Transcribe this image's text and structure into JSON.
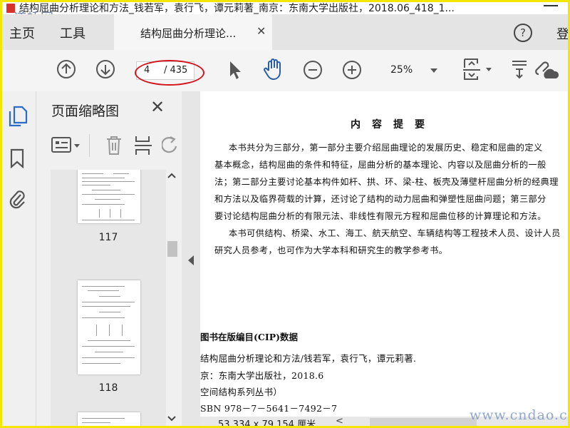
{
  "window": {
    "title": "结构屈曲分析理论和方法_钱若军，袁行飞，谭元莉著_南京：东南大学出版社，2018.06_418_1..."
  },
  "watermarks": {
    "top_left": "道桥网",
    "bottom_right": "www.cndao.com"
  },
  "menu": {
    "home": "主页",
    "tools": "工具",
    "tab_label": "结构屈曲分析理论...",
    "login": "登"
  },
  "toolbar": {
    "current_page": "4",
    "total_pages": "/ 435",
    "zoom": "25%"
  },
  "panel": {
    "title": "页面缩略图",
    "thumbnails": [
      {
        "label": "117"
      },
      {
        "label": "118"
      }
    ]
  },
  "document": {
    "heading": "内容提要",
    "summary_lines": [
      "本书共分为三部分，第一部分主要介绍屈曲理论的发展历史、稳定和屈曲的定义",
      "基本概念，结构屈曲的条件和特征，屈曲分析的基本理论、内容以及屈曲分析的一般",
      "法；第二部分主要讨论基本构件如杆、拱、环、梁-柱、板壳及薄壁杆屈曲分析的经典理",
      "和方法以及临界荷载的计算，还讨论了结构的动力屈曲和弹塑性屈曲问题；第三部分",
      "要讨论结构屈曲分析的有限元法、非线性有限元方程和屈曲位移的计算理论和方法。",
      "本书可供结构、桥梁、水工、海工、航天航空、车辆结构等工程技术人员、设计人员",
      "研究人员参考，也可作为大学本科和研究生的教学参考书。"
    ],
    "cip_heading": "图书在版编目(CIP)数据",
    "cip_lines": [
      "结构屈曲分析理论和方法/钱若军，袁行飞，谭元莉著.",
      "京：东南大学出版社，2018.6",
      "空间结构系列丛书）",
      "SBN 978－7－5641－7492－7"
    ]
  },
  "status": {
    "page_size": "53.334 x 79.154 厘米"
  },
  "colors": {
    "frame": "#f3e600",
    "annotation": "#d4141b",
    "pdf_icon": "#d8322c"
  }
}
